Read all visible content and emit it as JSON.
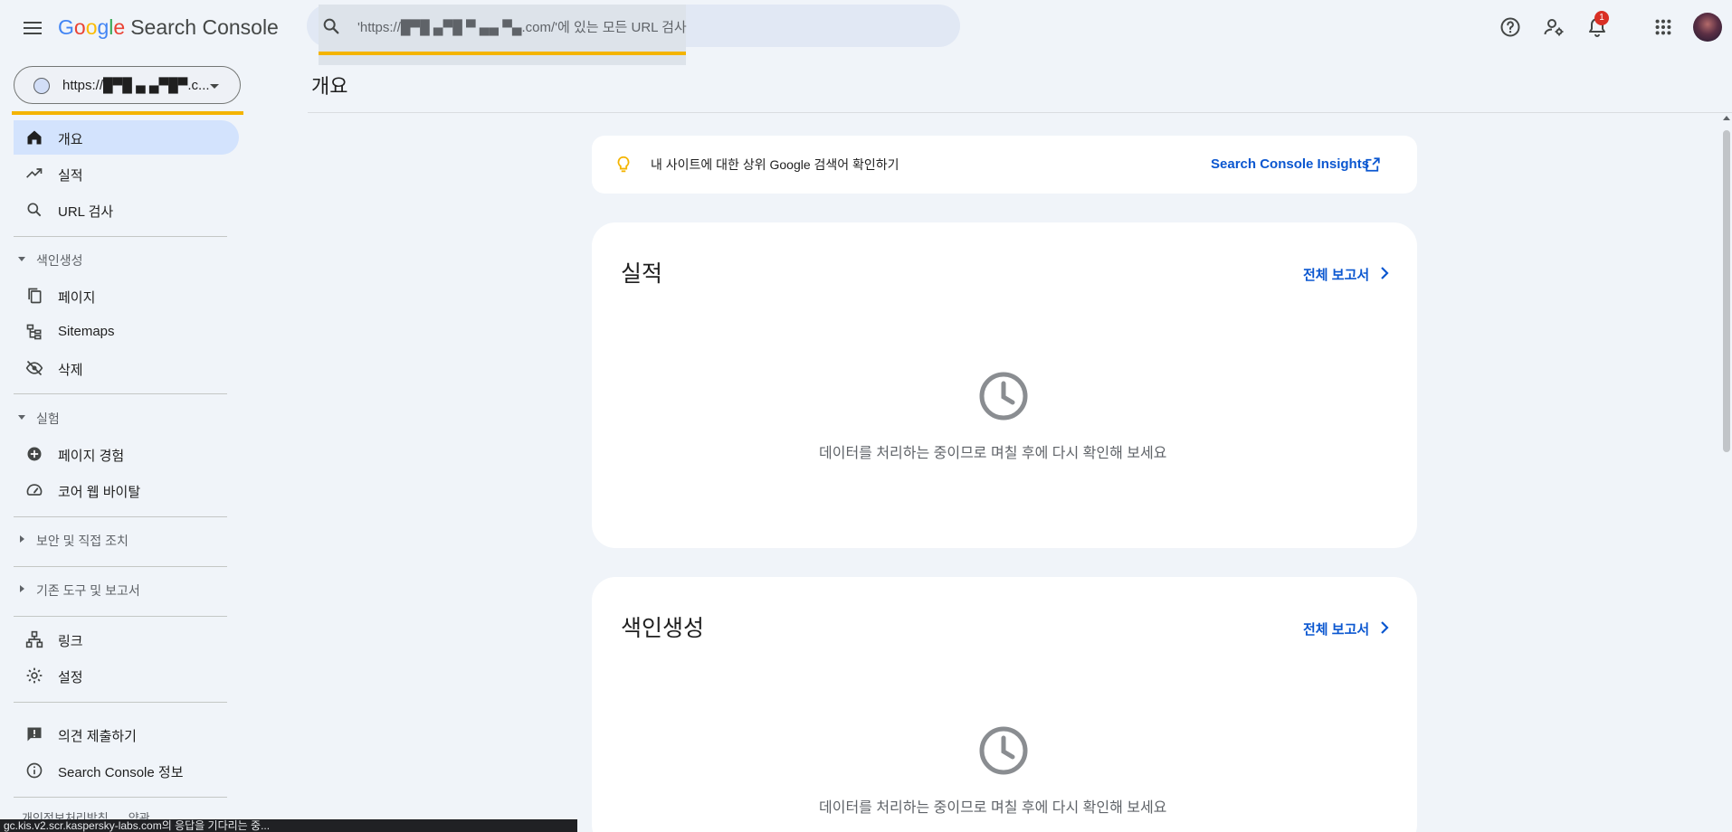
{
  "header": {
    "logo_letters": [
      "G",
      "o",
      "o",
      "g",
      "l",
      "e"
    ],
    "product_name": "Search Console",
    "search_placeholder": "'https://█▀█ ▄▀█ ▀ ▄▄ ▀▄.com/'에 있는 모든 URL 검사",
    "notification_count": "1",
    "icons": [
      "menu-icon",
      "search-icon",
      "help-icon",
      "manage-users-icon",
      "notifications-icon",
      "apps-icon"
    ]
  },
  "sidebar": {
    "property": "https://█▀█ ▄ ▄▀█▀.c...",
    "items_top": [
      {
        "label": "개요",
        "icon": "home-icon",
        "active": true
      },
      {
        "label": "실적",
        "icon": "trending-up-icon"
      },
      {
        "label": "URL 검사",
        "icon": "search-icon"
      }
    ],
    "sections": {
      "indexing": "색인생성",
      "experiments": "실험",
      "security": "보안 및 직접 조치",
      "legacy": "기존 도구 및 보고서"
    },
    "items_indexing": [
      {
        "label": "페이지",
        "icon": "pages-icon"
      },
      {
        "label": "Sitemaps",
        "icon": "sitemap-icon"
      },
      {
        "label": "삭제",
        "icon": "removals-icon"
      }
    ],
    "items_experiments": [
      {
        "label": "페이지 경험",
        "icon": "add-circle-icon"
      },
      {
        "label": "코어 웹 바이탈",
        "icon": "speed-icon"
      }
    ],
    "items_bottom": [
      {
        "label": "링크",
        "icon": "links-icon"
      },
      {
        "label": "설정",
        "icon": "settings-icon"
      }
    ],
    "items_feedback": [
      {
        "label": "의견 제출하기",
        "icon": "feedback-icon"
      },
      {
        "label": "Search Console 정보",
        "icon": "info-icon"
      }
    ],
    "footer_links": [
      "개인정보처리방침",
      "약관"
    ]
  },
  "status_bar": "gc.kis.v2.scr.kaspersky-labs.com의 응답을 기다리는 중...",
  "main": {
    "page_title": "개요",
    "insight": {
      "text": "내 사이트에 대한 상위 Google 검색어 확인하기",
      "link": "Search Console Insights"
    },
    "cards": [
      {
        "title": "실적",
        "link": "전체 보고서",
        "message": "데이터를 처리하는 중이므로 며칠 후에 다시 확인해 보세요"
      },
      {
        "title": "색인생성",
        "link": "전체 보고서",
        "message": "데이터를 처리하는 중이므로 며칠 후에 다시 확인해 보세요"
      }
    ]
  },
  "colors": {
    "accent_blue": "#0b57d0",
    "active_nav": "#d3e3fd",
    "highlight_yellow": "#f4b400",
    "badge_red": "#d93025",
    "background": "#f0f4f9"
  }
}
